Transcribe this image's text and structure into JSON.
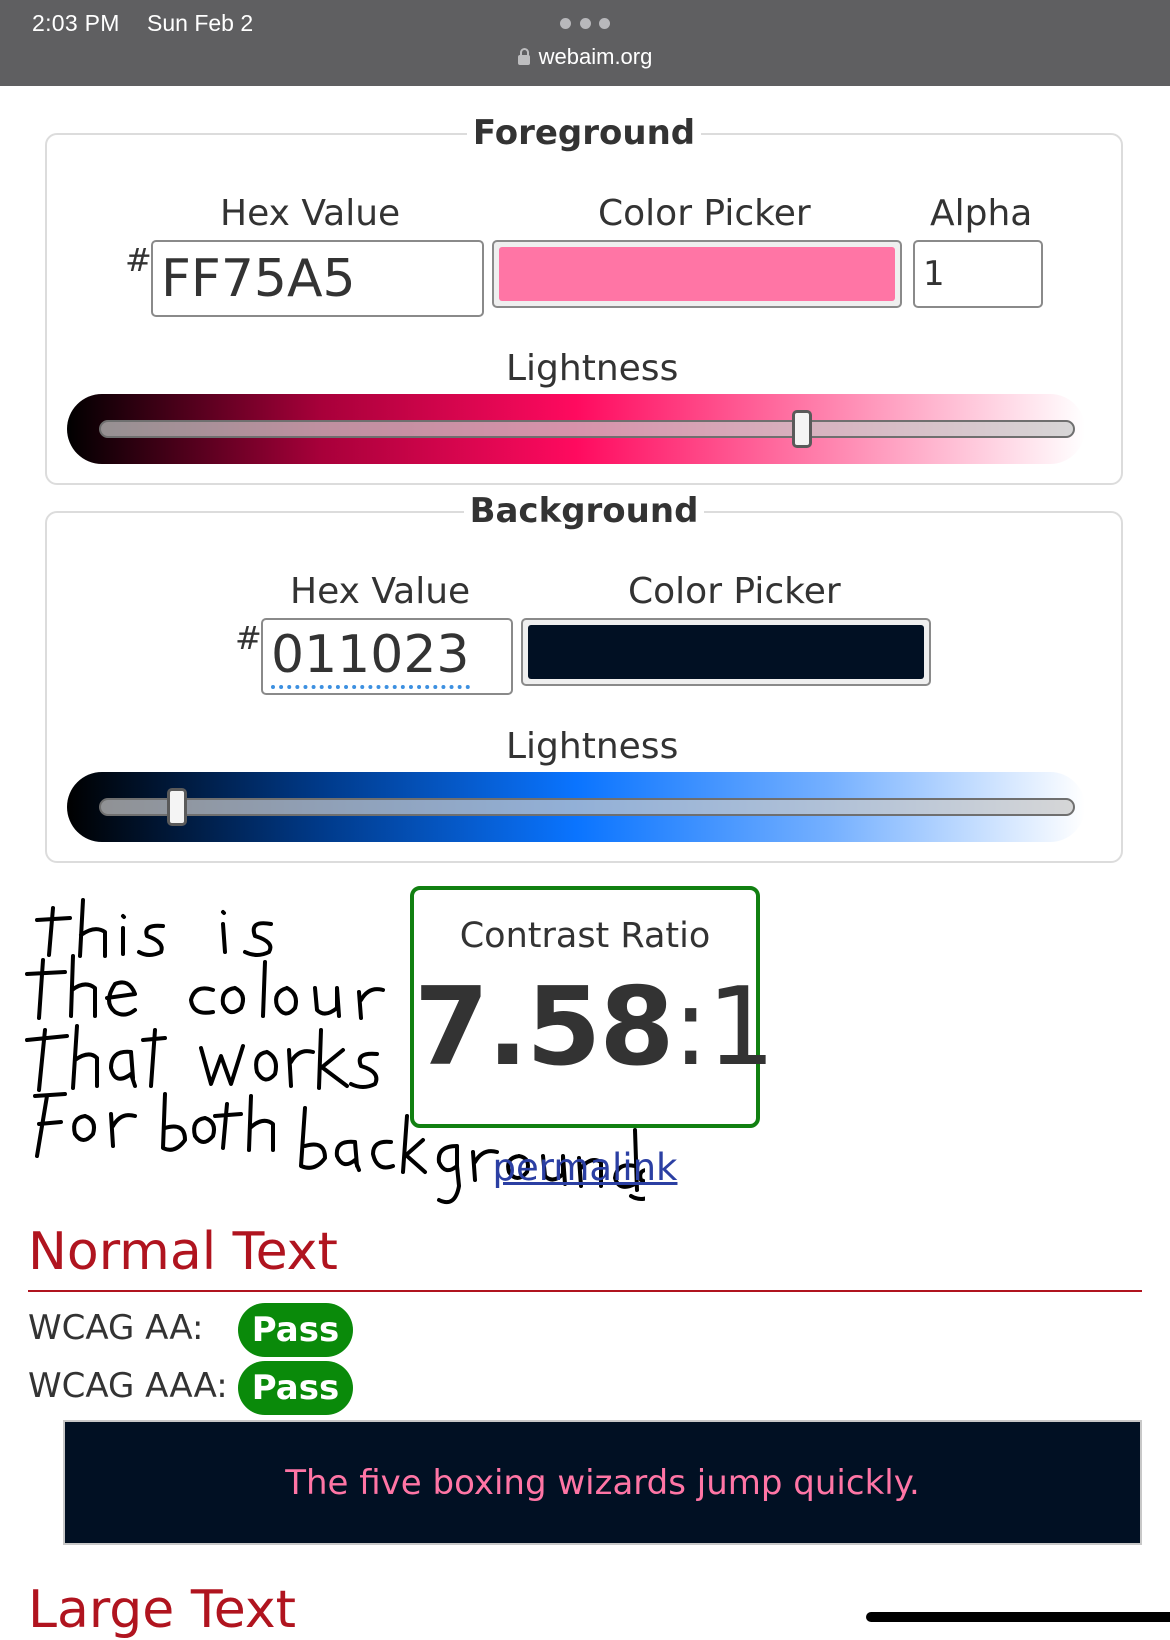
{
  "status_bar": {
    "time": "2:03 PM",
    "date": "Sun Feb 2",
    "url": "webaim.org"
  },
  "foreground": {
    "legend": "Foreground",
    "hex_label": "Hex Value",
    "hash": "#",
    "hex_value": "FF75A5",
    "picker_label": "Color Picker",
    "picker_color": "#FF75A5",
    "alpha_label": "Alpha",
    "alpha_value": "1",
    "lightness_label": "Lightness",
    "lightness_fraction": 0.72
  },
  "background": {
    "legend": "Background",
    "hex_label": "Hex Value",
    "hash": "#",
    "hex_value": "011023",
    "picker_label": "Color Picker",
    "picker_color": "#011023",
    "lightness_label": "Lightness",
    "lightness_fraction": 0.08
  },
  "contrast": {
    "label": "Contrast Ratio",
    "ratio_main": "7.58",
    "ratio_rest": ":1",
    "permalink": "permalink"
  },
  "annotation": {
    "handwritten_note": "this is the colour that works for both backgrounds"
  },
  "normal_text": {
    "title": "Normal Text",
    "wcag_aa_label": "WCAG AA:",
    "wcag_aa_result": "Pass",
    "wcag_aaa_label": "WCAG AAA:",
    "wcag_aaa_result": "Pass",
    "sample_text": "The five boxing wizards jump quickly."
  },
  "large_text": {
    "title": "Large Text"
  },
  "colors": {
    "pass_green": "#0a8a0a",
    "heading_red": "#b0141f",
    "link_blue": "#2b3fa3"
  }
}
